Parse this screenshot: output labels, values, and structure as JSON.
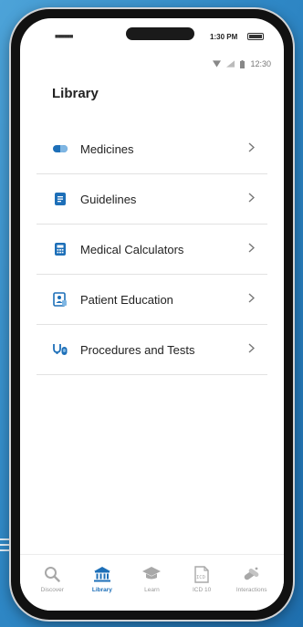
{
  "status_bar": {
    "time": "1:30 PM",
    "secondary_time": "12:30"
  },
  "page": {
    "title": "Library"
  },
  "library_items": [
    {
      "label": "Medicines",
      "icon": "pill-icon"
    },
    {
      "label": "Guidelines",
      "icon": "document-icon"
    },
    {
      "label": "Medical Calculators",
      "icon": "calculator-icon"
    },
    {
      "label": "Patient Education",
      "icon": "patient-education-icon"
    },
    {
      "label": "Procedures and Tests",
      "icon": "stethoscope-icon"
    }
  ],
  "bottom_nav": {
    "active": "Library",
    "items": [
      {
        "label": "Discover",
        "icon": "search-icon"
      },
      {
        "label": "Library",
        "icon": "library-icon"
      },
      {
        "label": "Learn",
        "icon": "graduation-cap-icon"
      },
      {
        "label": "ICD 10",
        "icon": "icd-document-icon",
        "icon_text": "ICD"
      },
      {
        "label": "Interactions",
        "icon": "interactions-icon"
      }
    ]
  },
  "colors": {
    "accent": "#1d6fb8",
    "inactive": "#9a9a9a",
    "background": "#2f88c6"
  }
}
